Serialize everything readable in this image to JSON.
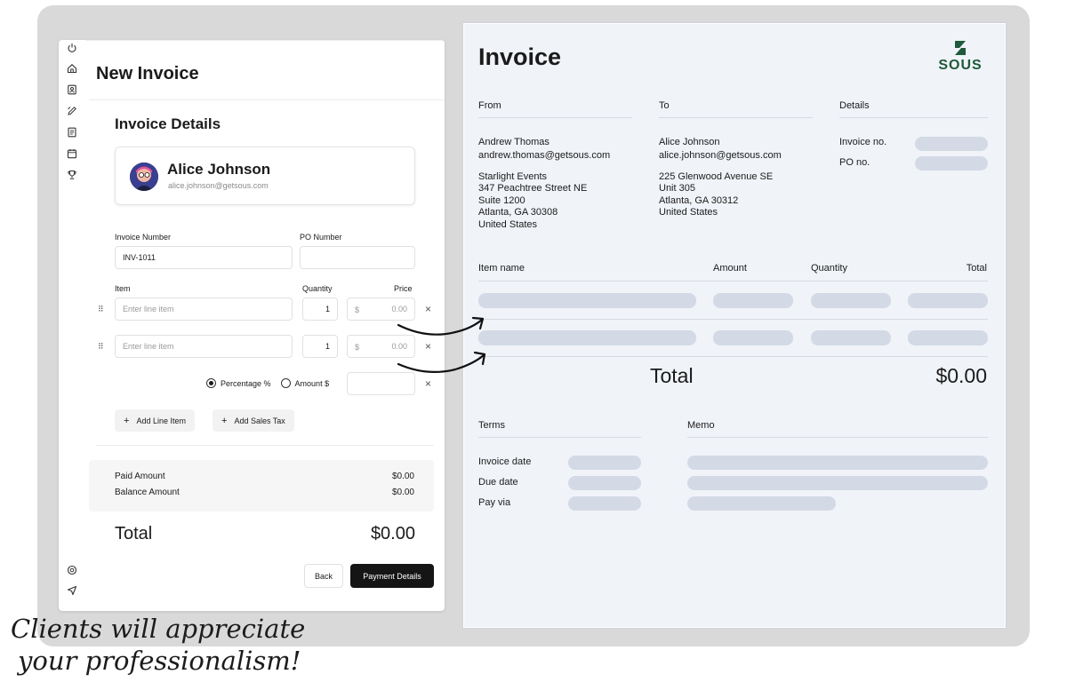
{
  "app": {
    "title": "New Invoice",
    "section_title": "Invoice Details",
    "client": {
      "name": "Alice Johnson",
      "email": "alice.johnson@getsous.com"
    },
    "fields": {
      "invoice_number_label": "Invoice Number",
      "invoice_number_value": "INV-1011",
      "po_number_label": "PO Number",
      "po_number_value": ""
    },
    "line_items": {
      "headers": {
        "item": "Item",
        "quantity": "Quantity",
        "price": "Price"
      },
      "rows": [
        {
          "placeholder": "Enter line item",
          "quantity": "1",
          "currency": "$",
          "price": "0.00"
        },
        {
          "placeholder": "Enter line item",
          "quantity": "1",
          "currency": "$",
          "price": "0.00"
        }
      ]
    },
    "discount": {
      "percentage_label": "Percentage %",
      "amount_label": "Amount $",
      "selected": "percentage"
    },
    "buttons": {
      "add_line_item": "Add Line Item",
      "add_sales_tax": "Add Sales Tax",
      "back": "Back",
      "payment_details": "Payment Details"
    },
    "amounts": {
      "paid_label": "Paid Amount",
      "paid_value": "$0.00",
      "balance_label": "Balance Amount",
      "balance_value": "$0.00"
    },
    "total": {
      "label": "Total",
      "value": "$0.00"
    }
  },
  "invoice": {
    "title": "Invoice",
    "logo_text": "SOUS",
    "from": {
      "label": "From",
      "name": "Andrew Thomas",
      "email": "andrew.thomas@getsous.com",
      "address": [
        "Starlight Events",
        "347 Peachtree Street NE",
        "Suite 1200",
        "Atlanta, GA 30308",
        "United States"
      ]
    },
    "to": {
      "label": "To",
      "name": "Alice Johnson",
      "email": "alice.johnson@getsous.com",
      "address": [
        "225 Glenwood Avenue SE",
        "Unit 305",
        "Atlanta, GA 30312",
        "United States"
      ]
    },
    "details": {
      "label": "Details",
      "invoice_no_label": "Invoice no.",
      "po_no_label": "PO no."
    },
    "table_headers": {
      "item_name": "Item name",
      "amount": "Amount",
      "quantity": "Quantity",
      "total": "Total"
    },
    "total": {
      "label": "Total",
      "value": "$0.00"
    },
    "terms": {
      "label": "Terms",
      "invoice_date": "Invoice date",
      "due_date": "Due date",
      "pay_via": "Pay via"
    },
    "memo": {
      "label": "Memo"
    }
  },
  "caption": {
    "line1": "Clients will appreciate",
    "line2": "your professionalism!"
  },
  "colors": {
    "primary_button": "#151515",
    "skeleton": "#d3dae6",
    "sheet_bg": "#f0f3f8",
    "logo_green": "#1f5a3a"
  }
}
